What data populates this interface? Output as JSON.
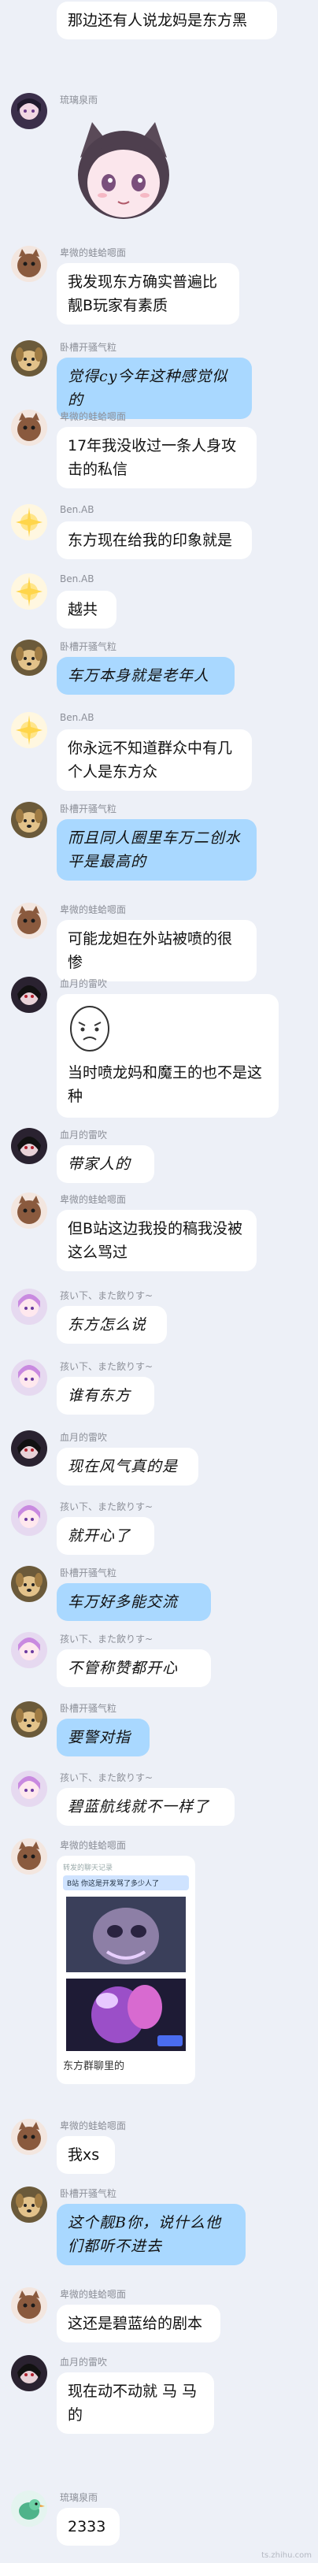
{
  "colors": {
    "background": "#edf0f7",
    "bubble_white": "#ffffff",
    "bubble_blue": "#a9d8ff",
    "name_gray": "#8c8f98"
  },
  "messages": [
    {
      "sender": "",
      "text": "那边还有人说龙妈是东方黑",
      "avatar": "none",
      "style": "white"
    },
    {
      "sender": "琉璃泉雨",
      "text": "",
      "avatar": "anime-girl",
      "style": "sticker-cat"
    },
    {
      "sender": "卑微的蛙蛤嗯面",
      "text": "我发现东方确实普遍比靓B玩家有素质",
      "avatar": "brown-cat",
      "style": "white"
    },
    {
      "sender": "卧槽开骚气粒",
      "text": "觉得cy今年这种感觉似的",
      "avatar": "dog",
      "style": "blue-hand"
    },
    {
      "sender": "卑微的蛙蛤嗯面",
      "text": "17年我没收过一条人身攻击的私信",
      "avatar": "brown-cat",
      "style": "white"
    },
    {
      "sender": "Ben.AB",
      "text": "东方现在给我的印象就是",
      "avatar": "sparkle",
      "style": "white"
    },
    {
      "sender": "Ben.AB",
      "text": "越共",
      "avatar": "sparkle",
      "style": "white"
    },
    {
      "sender": "卧槽开骚气粒",
      "text": "车万本身就是老年人",
      "avatar": "dog",
      "style": "blue-hand"
    },
    {
      "sender": "Ben.AB",
      "text": "你永远不知道群众中有几个人是东方众",
      "avatar": "sparkle",
      "style": "white"
    },
    {
      "sender": "卧槽开骚气粒",
      "text": "而且同人圈里车万二创水平是最高的",
      "avatar": "dog",
      "style": "blue-hand"
    },
    {
      "sender": "卑微的蛙蛤嗯面",
      "text": "可能龙妲在外站被喷的很惨",
      "avatar": "brown-cat",
      "style": "white"
    },
    {
      "sender": "血月的雷吹",
      "text": "当时喷龙妈和魔王的也不是这种",
      "avatar": "dark-char",
      "style": "sticker-face"
    },
    {
      "sender": "血月的雷吹",
      "text": "带家人的",
      "avatar": "dark-char",
      "style": "white-hand"
    },
    {
      "sender": "卑微的蛙蛤嗯面",
      "text": "但B站这边我投的稿我没被这么骂过",
      "avatar": "brown-cat",
      "style": "white"
    },
    {
      "sender": "孩い下、また飲りす~",
      "text": "东方怎么说",
      "avatar": "pink-girl",
      "style": "white-hand"
    },
    {
      "sender": "孩い下、また飲りす~",
      "text": "谁有东方",
      "avatar": "pink-girl",
      "style": "white-hand"
    },
    {
      "sender": "血月的雷吹",
      "text": "现在风气真的是",
      "avatar": "dark-char",
      "style": "white-hand"
    },
    {
      "sender": "孩い下、また飲りす~",
      "text": "就开心了",
      "avatar": "pink-girl",
      "style": "white-hand"
    },
    {
      "sender": "卧槽开骚气粒",
      "text": "车万好多能交流",
      "avatar": "dog",
      "style": "blue-hand"
    },
    {
      "sender": "孩い下、また飲りす~",
      "text": "不管称赞都开心",
      "avatar": "pink-girl",
      "style": "white-hand"
    },
    {
      "sender": "卧槽开骚气粒",
      "text": "要警对指",
      "avatar": "dog",
      "style": "blue-hand"
    },
    {
      "sender": "孩い下、また飲りす~",
      "text": "碧蓝航线就不一样了",
      "avatar": "pink-girl",
      "style": "white-hand"
    },
    {
      "sender": "卑微的蛙蛤嗯面",
      "text": "",
      "avatar": "brown-cat",
      "style": "image-card",
      "card_caption": "东方群聊里的",
      "card_header": "转发的聊天记录",
      "card_line": "B站 你这是开发骂了多少人了"
    },
    {
      "sender": "卑微的蛙蛤嗯面",
      "text": "我xs",
      "avatar": "brown-cat",
      "style": "white"
    },
    {
      "sender": "卧槽开骚气粒",
      "text": "这个靓B你，说什么他们都听不进去",
      "avatar": "dog",
      "style": "blue-hand"
    },
    {
      "sender": "卑微的蛙蛤嗯面",
      "text": "这还是碧蓝给的剧本",
      "avatar": "brown-cat",
      "style": "white"
    },
    {
      "sender": "血月的雷吹",
      "text": "现在动不动就 马 马 的",
      "avatar": "dark-char",
      "style": "white-horse"
    },
    {
      "sender": "琉璃泉雨",
      "text": "2333",
      "avatar": "green-bird",
      "style": "white"
    }
  ],
  "watermark": "ts.zhihu.com"
}
